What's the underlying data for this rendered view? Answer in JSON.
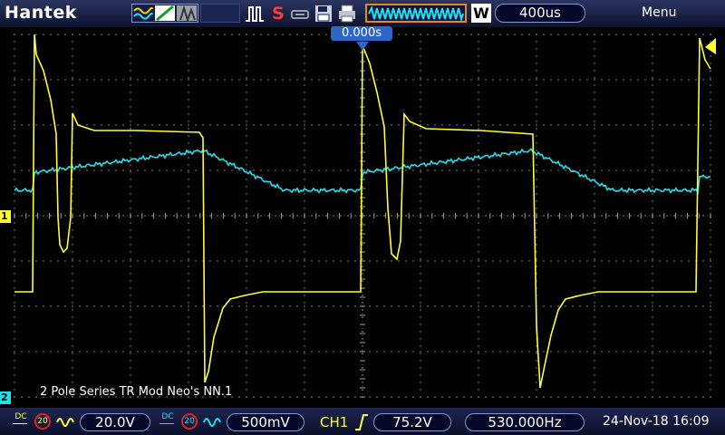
{
  "top": {
    "brand": "Hantek",
    "timebase": "400us",
    "window_mode": "W",
    "menu_label": "Menu",
    "run_status": "S"
  },
  "screen": {
    "trigger_position": "0.000s",
    "caption": "2 Pole Series TR Mod Neo's NN.1",
    "ch1_marker": "1",
    "ch2_marker": "2"
  },
  "bottom": {
    "ch1": {
      "coupling": "DC",
      "bw_limit": "20",
      "scale": "20.0V"
    },
    "ch2": {
      "coupling": "DC",
      "bw_limit": "20",
      "scale": "500mV"
    },
    "trigger": {
      "source": "CH1",
      "level": "75.2V"
    },
    "frequency": "530.000Hz",
    "datetime": "24-Nov-18 16:09"
  },
  "colors": {
    "ch1": "#ffff2e",
    "ch2": "#20e0ee",
    "grid": "#9aa0a8",
    "accent": "#e08a20",
    "trigger_badge": "#2f67c9"
  }
}
